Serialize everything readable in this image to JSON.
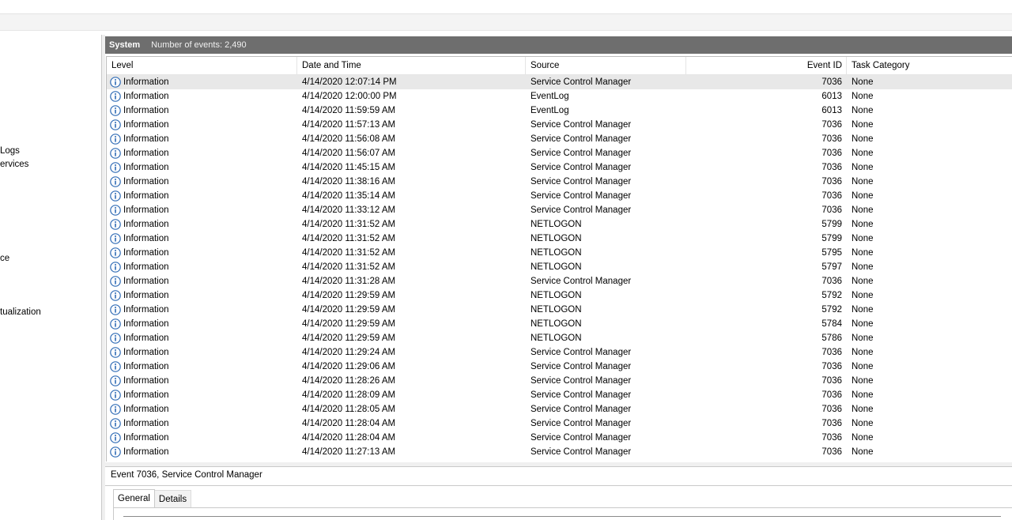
{
  "sidebar": {
    "items": [
      {
        "label": "Logs"
      },
      {
        "label": "ervices"
      },
      {
        "label": "ce"
      },
      {
        "label": "tualization"
      }
    ]
  },
  "panel": {
    "title": "System",
    "event_count": "Number of events: 2,490"
  },
  "table": {
    "columns": [
      "Level",
      "Date and Time",
      "Source",
      "Event ID",
      "Task Category"
    ],
    "rows": [
      {
        "level": "Information",
        "date": "4/14/2020 12:07:14 PM",
        "source": "Service Control Manager",
        "id": "7036",
        "task": "None"
      },
      {
        "level": "Information",
        "date": "4/14/2020 12:00:00 PM",
        "source": "EventLog",
        "id": "6013",
        "task": "None"
      },
      {
        "level": "Information",
        "date": "4/14/2020 11:59:59 AM",
        "source": "EventLog",
        "id": "6013",
        "task": "None"
      },
      {
        "level": "Information",
        "date": "4/14/2020 11:57:13 AM",
        "source": "Service Control Manager",
        "id": "7036",
        "task": "None"
      },
      {
        "level": "Information",
        "date": "4/14/2020 11:56:08 AM",
        "source": "Service Control Manager",
        "id": "7036",
        "task": "None"
      },
      {
        "level": "Information",
        "date": "4/14/2020 11:56:07 AM",
        "source": "Service Control Manager",
        "id": "7036",
        "task": "None"
      },
      {
        "level": "Information",
        "date": "4/14/2020 11:45:15 AM",
        "source": "Service Control Manager",
        "id": "7036",
        "task": "None"
      },
      {
        "level": "Information",
        "date": "4/14/2020 11:38:16 AM",
        "source": "Service Control Manager",
        "id": "7036",
        "task": "None"
      },
      {
        "level": "Information",
        "date": "4/14/2020 11:35:14 AM",
        "source": "Service Control Manager",
        "id": "7036",
        "task": "None"
      },
      {
        "level": "Information",
        "date": "4/14/2020 11:33:12 AM",
        "source": "Service Control Manager",
        "id": "7036",
        "task": "None"
      },
      {
        "level": "Information",
        "date": "4/14/2020 11:31:52 AM",
        "source": "NETLOGON",
        "id": "5799",
        "task": "None"
      },
      {
        "level": "Information",
        "date": "4/14/2020 11:31:52 AM",
        "source": "NETLOGON",
        "id": "5799",
        "task": "None"
      },
      {
        "level": "Information",
        "date": "4/14/2020 11:31:52 AM",
        "source": "NETLOGON",
        "id": "5795",
        "task": "None"
      },
      {
        "level": "Information",
        "date": "4/14/2020 11:31:52 AM",
        "source": "NETLOGON",
        "id": "5797",
        "task": "None"
      },
      {
        "level": "Information",
        "date": "4/14/2020 11:31:28 AM",
        "source": "Service Control Manager",
        "id": "7036",
        "task": "None"
      },
      {
        "level": "Information",
        "date": "4/14/2020 11:29:59 AM",
        "source": "NETLOGON",
        "id": "5792",
        "task": "None"
      },
      {
        "level": "Information",
        "date": "4/14/2020 11:29:59 AM",
        "source": "NETLOGON",
        "id": "5792",
        "task": "None"
      },
      {
        "level": "Information",
        "date": "4/14/2020 11:29:59 AM",
        "source": "NETLOGON",
        "id": "5784",
        "task": "None"
      },
      {
        "level": "Information",
        "date": "4/14/2020 11:29:59 AM",
        "source": "NETLOGON",
        "id": "5786",
        "task": "None"
      },
      {
        "level": "Information",
        "date": "4/14/2020 11:29:24 AM",
        "source": "Service Control Manager",
        "id": "7036",
        "task": "None"
      },
      {
        "level": "Information",
        "date": "4/14/2020 11:29:06 AM",
        "source": "Service Control Manager",
        "id": "7036",
        "task": "None"
      },
      {
        "level": "Information",
        "date": "4/14/2020 11:28:26 AM",
        "source": "Service Control Manager",
        "id": "7036",
        "task": "None"
      },
      {
        "level": "Information",
        "date": "4/14/2020 11:28:09 AM",
        "source": "Service Control Manager",
        "id": "7036",
        "task": "None"
      },
      {
        "level": "Information",
        "date": "4/14/2020 11:28:05 AM",
        "source": "Service Control Manager",
        "id": "7036",
        "task": "None"
      },
      {
        "level": "Information",
        "date": "4/14/2020 11:28:04 AM",
        "source": "Service Control Manager",
        "id": "7036",
        "task": "None"
      },
      {
        "level": "Information",
        "date": "4/14/2020 11:28:04 AM",
        "source": "Service Control Manager",
        "id": "7036",
        "task": "None"
      },
      {
        "level": "Information",
        "date": "4/14/2020 11:27:13 AM",
        "source": "Service Control Manager",
        "id": "7036",
        "task": "None"
      }
    ]
  },
  "details": {
    "title": "Event 7036, Service Control Manager",
    "tabs": [
      {
        "label": "General"
      },
      {
        "label": "Details"
      }
    ]
  },
  "icons": {
    "level_icon": "information-icon"
  },
  "colors": {
    "title_bar": "#6e6e6e",
    "info_icon": "#2f6bb5",
    "selected_row": "#e8e8e8"
  }
}
